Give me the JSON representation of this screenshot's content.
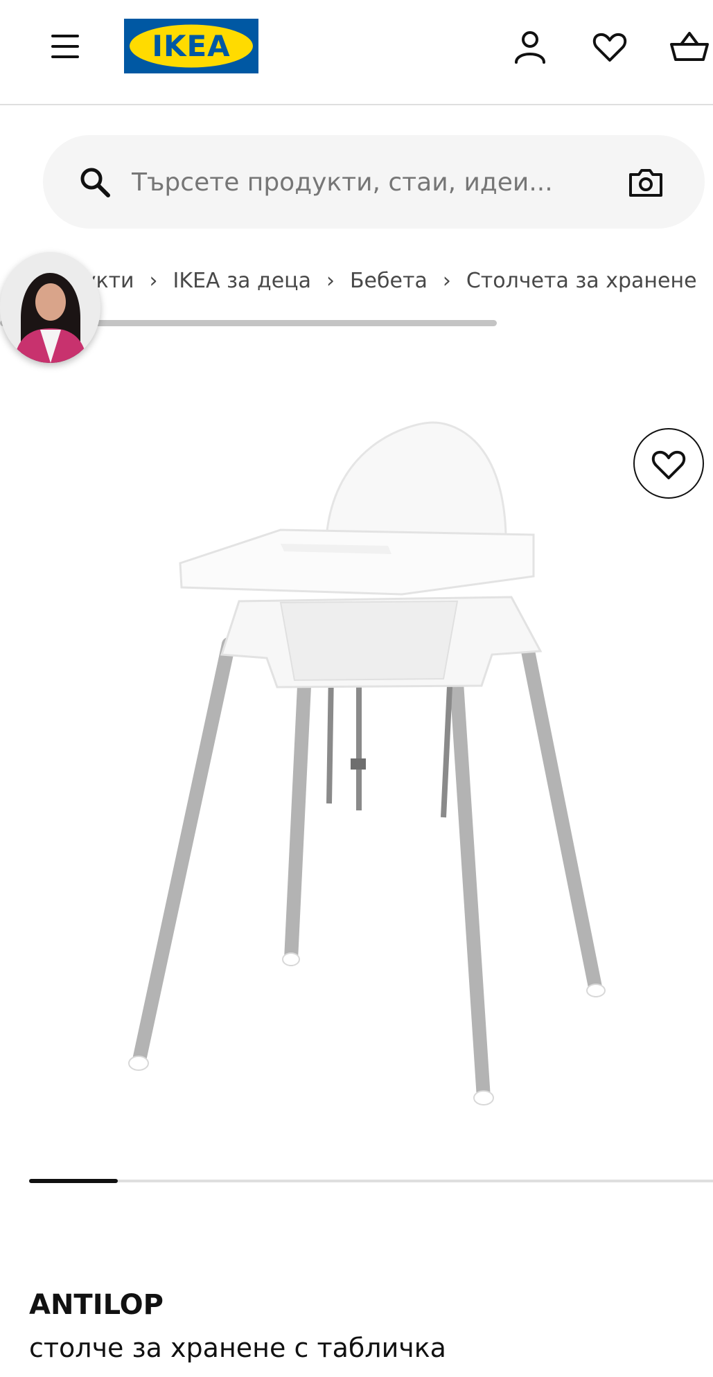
{
  "header": {
    "logo_text": "IKEA",
    "icons": [
      "menu-icon",
      "user-icon",
      "heart-icon",
      "shopping-bag-icon"
    ]
  },
  "search": {
    "placeholder": "Търсете продукти, стаи, идеи...",
    "icons": [
      "search-icon",
      "camera-icon"
    ]
  },
  "breadcrumb": {
    "items": [
      "Продукти",
      "IKEA за деца",
      "Бебета",
      "Столчета за хранене"
    ],
    "separator": "›"
  },
  "product": {
    "name": "ANTILOP",
    "description": "столче за хранене с табличка",
    "carousel": {
      "current": 1,
      "visible_fraction": 0.13
    }
  },
  "colors": {
    "brand_blue": "#0058a3",
    "brand_yellow": "#ffdb00",
    "text": "#111111",
    "muted_text": "#484848",
    "search_bg": "#f5f5f5"
  }
}
